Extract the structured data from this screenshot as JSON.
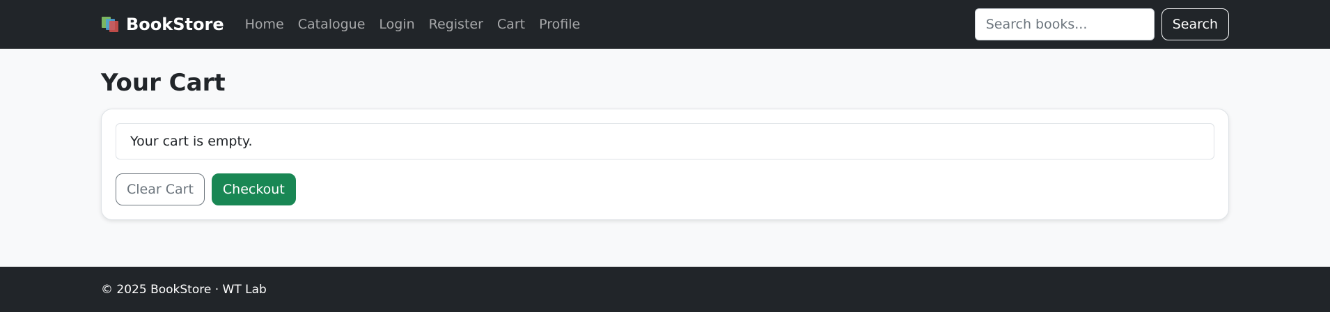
{
  "navbar": {
    "brand": "BookStore",
    "links": [
      "Home",
      "Catalogue",
      "Login",
      "Register",
      "Cart",
      "Profile"
    ],
    "search_placeholder": "Search books...",
    "search_button": "Search"
  },
  "main": {
    "title": "Your Cart",
    "empty_message": "Your cart is empty.",
    "clear_button": "Clear Cart",
    "checkout_button": "Checkout"
  },
  "footer": {
    "text": "© 2025 BookStore · WT Lab"
  },
  "colors": {
    "navbar_bg": "#212529",
    "page_bg": "#f8f9fa",
    "checkout": "#198754",
    "outline": "#6c757d"
  }
}
